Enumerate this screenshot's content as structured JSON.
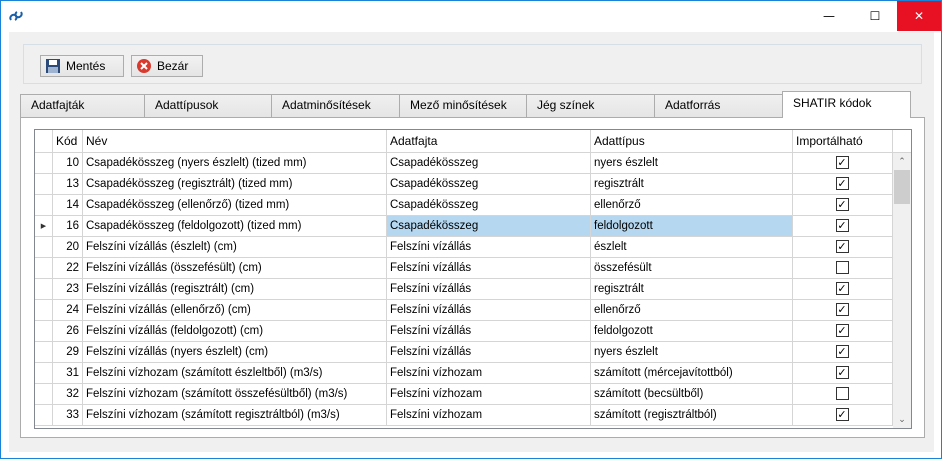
{
  "window": {
    "close_glyph": "✕",
    "minimize_glyph": "—",
    "maximize_glyph": "☐"
  },
  "toolbar": {
    "save_label": "Mentés",
    "close_label": "Bezár"
  },
  "tabs": [
    {
      "label": "Adatfajták"
    },
    {
      "label": "Adattípusok"
    },
    {
      "label": "Adatminősítések"
    },
    {
      "label": "Mező minősítések"
    },
    {
      "label": "Jég színek"
    },
    {
      "label": "Adatforrás"
    },
    {
      "label": "SHATIR kódok",
      "active": true
    }
  ],
  "grid": {
    "columns": [
      "Kód",
      "Név",
      "Adatfajta",
      "Adattípus",
      "Importálható"
    ],
    "current_row_marker": "▶",
    "selected_row_index": 3,
    "rows": [
      {
        "kod": "10",
        "nev": "Csapadékösszeg (nyers észlelt) (tized mm)",
        "adatfajta": "Csapadékösszeg",
        "adattipus": "nyers észlelt",
        "importalhato": true
      },
      {
        "kod": "13",
        "nev": "Csapadékösszeg (regisztrált) (tized mm)",
        "adatfajta": "Csapadékösszeg",
        "adattipus": "regisztrált",
        "importalhato": true
      },
      {
        "kod": "14",
        "nev": "Csapadékösszeg (ellenőrző) (tized mm)",
        "adatfajta": "Csapadékösszeg",
        "adattipus": "ellenőrző",
        "importalhato": true
      },
      {
        "kod": "16",
        "nev": "Csapadékösszeg (feldolgozott) (tized mm)",
        "adatfajta": "Csapadékösszeg",
        "adattipus": "feldolgozott",
        "importalhato": true
      },
      {
        "kod": "20",
        "nev": "Felszíni vízállás (észlelt) (cm)",
        "adatfajta": "Felszíni vízállás",
        "adattipus": "észlelt",
        "importalhato": true
      },
      {
        "kod": "22",
        "nev": "Felszíni vízállás (összefésült) (cm)",
        "adatfajta": "Felszíni vízállás",
        "adattipus": "összefésült",
        "importalhato": false
      },
      {
        "kod": "23",
        "nev": "Felszíni vízállás (regisztrált) (cm)",
        "adatfajta": "Felszíni vízállás",
        "adattipus": "regisztrált",
        "importalhato": true
      },
      {
        "kod": "24",
        "nev": "Felszíni vízállás (ellenőrző) (cm)",
        "adatfajta": "Felszíni vízállás",
        "adattipus": "ellenőrző",
        "importalhato": true
      },
      {
        "kod": "26",
        "nev": "Felszíni vízállás (feldolgozott) (cm)",
        "adatfajta": "Felszíni vízállás",
        "adattipus": "feldolgozott",
        "importalhato": true
      },
      {
        "kod": "29",
        "nev": "Felszíni vízállás (nyers észlelt) (cm)",
        "adatfajta": "Felszíni vízállás",
        "adattipus": "nyers észlelt",
        "importalhato": true
      },
      {
        "kod": "31",
        "nev": "Felszíni vízhozam (számított észleltből) (m3/s)",
        "adatfajta": "Felszíni vízhozam",
        "adattipus": "számított (mércejavítottból)",
        "importalhato": true
      },
      {
        "kod": "32",
        "nev": "Felszíni vízhozam (számított összefésültből)  (m3/s)",
        "adatfajta": "Felszíni vízhozam",
        "adattipus": "számított (becsültből)",
        "importalhato": false
      },
      {
        "kod": "33",
        "nev": "Felszíni vízhozam (számított regisztráltból) (m3/s)",
        "adatfajta": "Felszíni vízhozam",
        "adattipus": "számított (regisztráltból)",
        "importalhato": true
      }
    ]
  },
  "colors": {
    "selection": "#b5d7f0",
    "close_button": "#e81123",
    "window_border": "#1883d7"
  }
}
